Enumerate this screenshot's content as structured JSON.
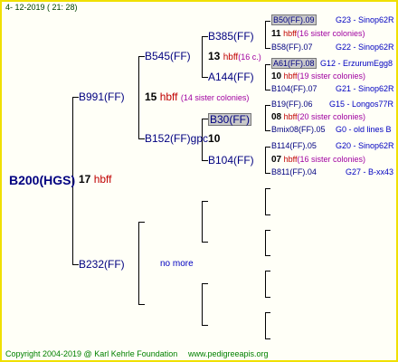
{
  "date": "4- 12-2019 ( 21: 28)",
  "root": {
    "label": "B200(HGS)",
    "count": "17",
    "hbff": "hbff"
  },
  "b991": {
    "label": "B991(FF)",
    "count": "15",
    "hbff": "hbff",
    "sis": "(14 sister colonies)"
  },
  "b232": {
    "label": "B232(FF)",
    "nomore": "no more"
  },
  "b545": {
    "label": "B545(FF)"
  },
  "b152": {
    "label": "B152(FF)gpc",
    "count": "10"
  },
  "b385": {
    "label": "B385(FF)",
    "count": "13",
    "hbff": "hbff",
    "sis": "(16 c.)"
  },
  "a144": {
    "label": "A144(FF)"
  },
  "b30": {
    "label": "B30(FF)"
  },
  "b104": {
    "label": "B104(FF)"
  },
  "leaves": [
    {
      "label": "B50(FF).09",
      "info": "G23 - Sinop62R"
    },
    {
      "count": "11",
      "hbff": "hbff",
      "sis": "(16 sister colonies)"
    },
    {
      "label": "B58(FF).07",
      "info": "G22 - Sinop62R"
    },
    {
      "label": "A61(FF).08",
      "info": "G12 - ErzurumEgg8"
    },
    {
      "count": "10",
      "hbff": "hbff",
      "sis": "(19 sister colonies)"
    },
    {
      "label": "B104(FF).07",
      "info": "G21 - Sinop62R"
    },
    {
      "label": "B19(FF).06",
      "info": "G15 - Longos77R"
    },
    {
      "count": "08",
      "hbff": "hbff",
      "sis": "(20 sister colonies)"
    },
    {
      "label": "Bmix08(FF).05",
      "info": "G0 - old lines B"
    },
    {
      "label": "B114(FF).05",
      "info": "G20 - Sinop62R"
    },
    {
      "count": "07",
      "hbff": "hbff",
      "sis": "(16 sister colonies)"
    },
    {
      "label": "B811(FF).04",
      "info": "G27 - B-xx43"
    }
  ],
  "footer": {
    "copyright": "Copyright 2004-2019 @ Karl Kehrle Foundation",
    "url": "www.pedigreeapis.org"
  }
}
